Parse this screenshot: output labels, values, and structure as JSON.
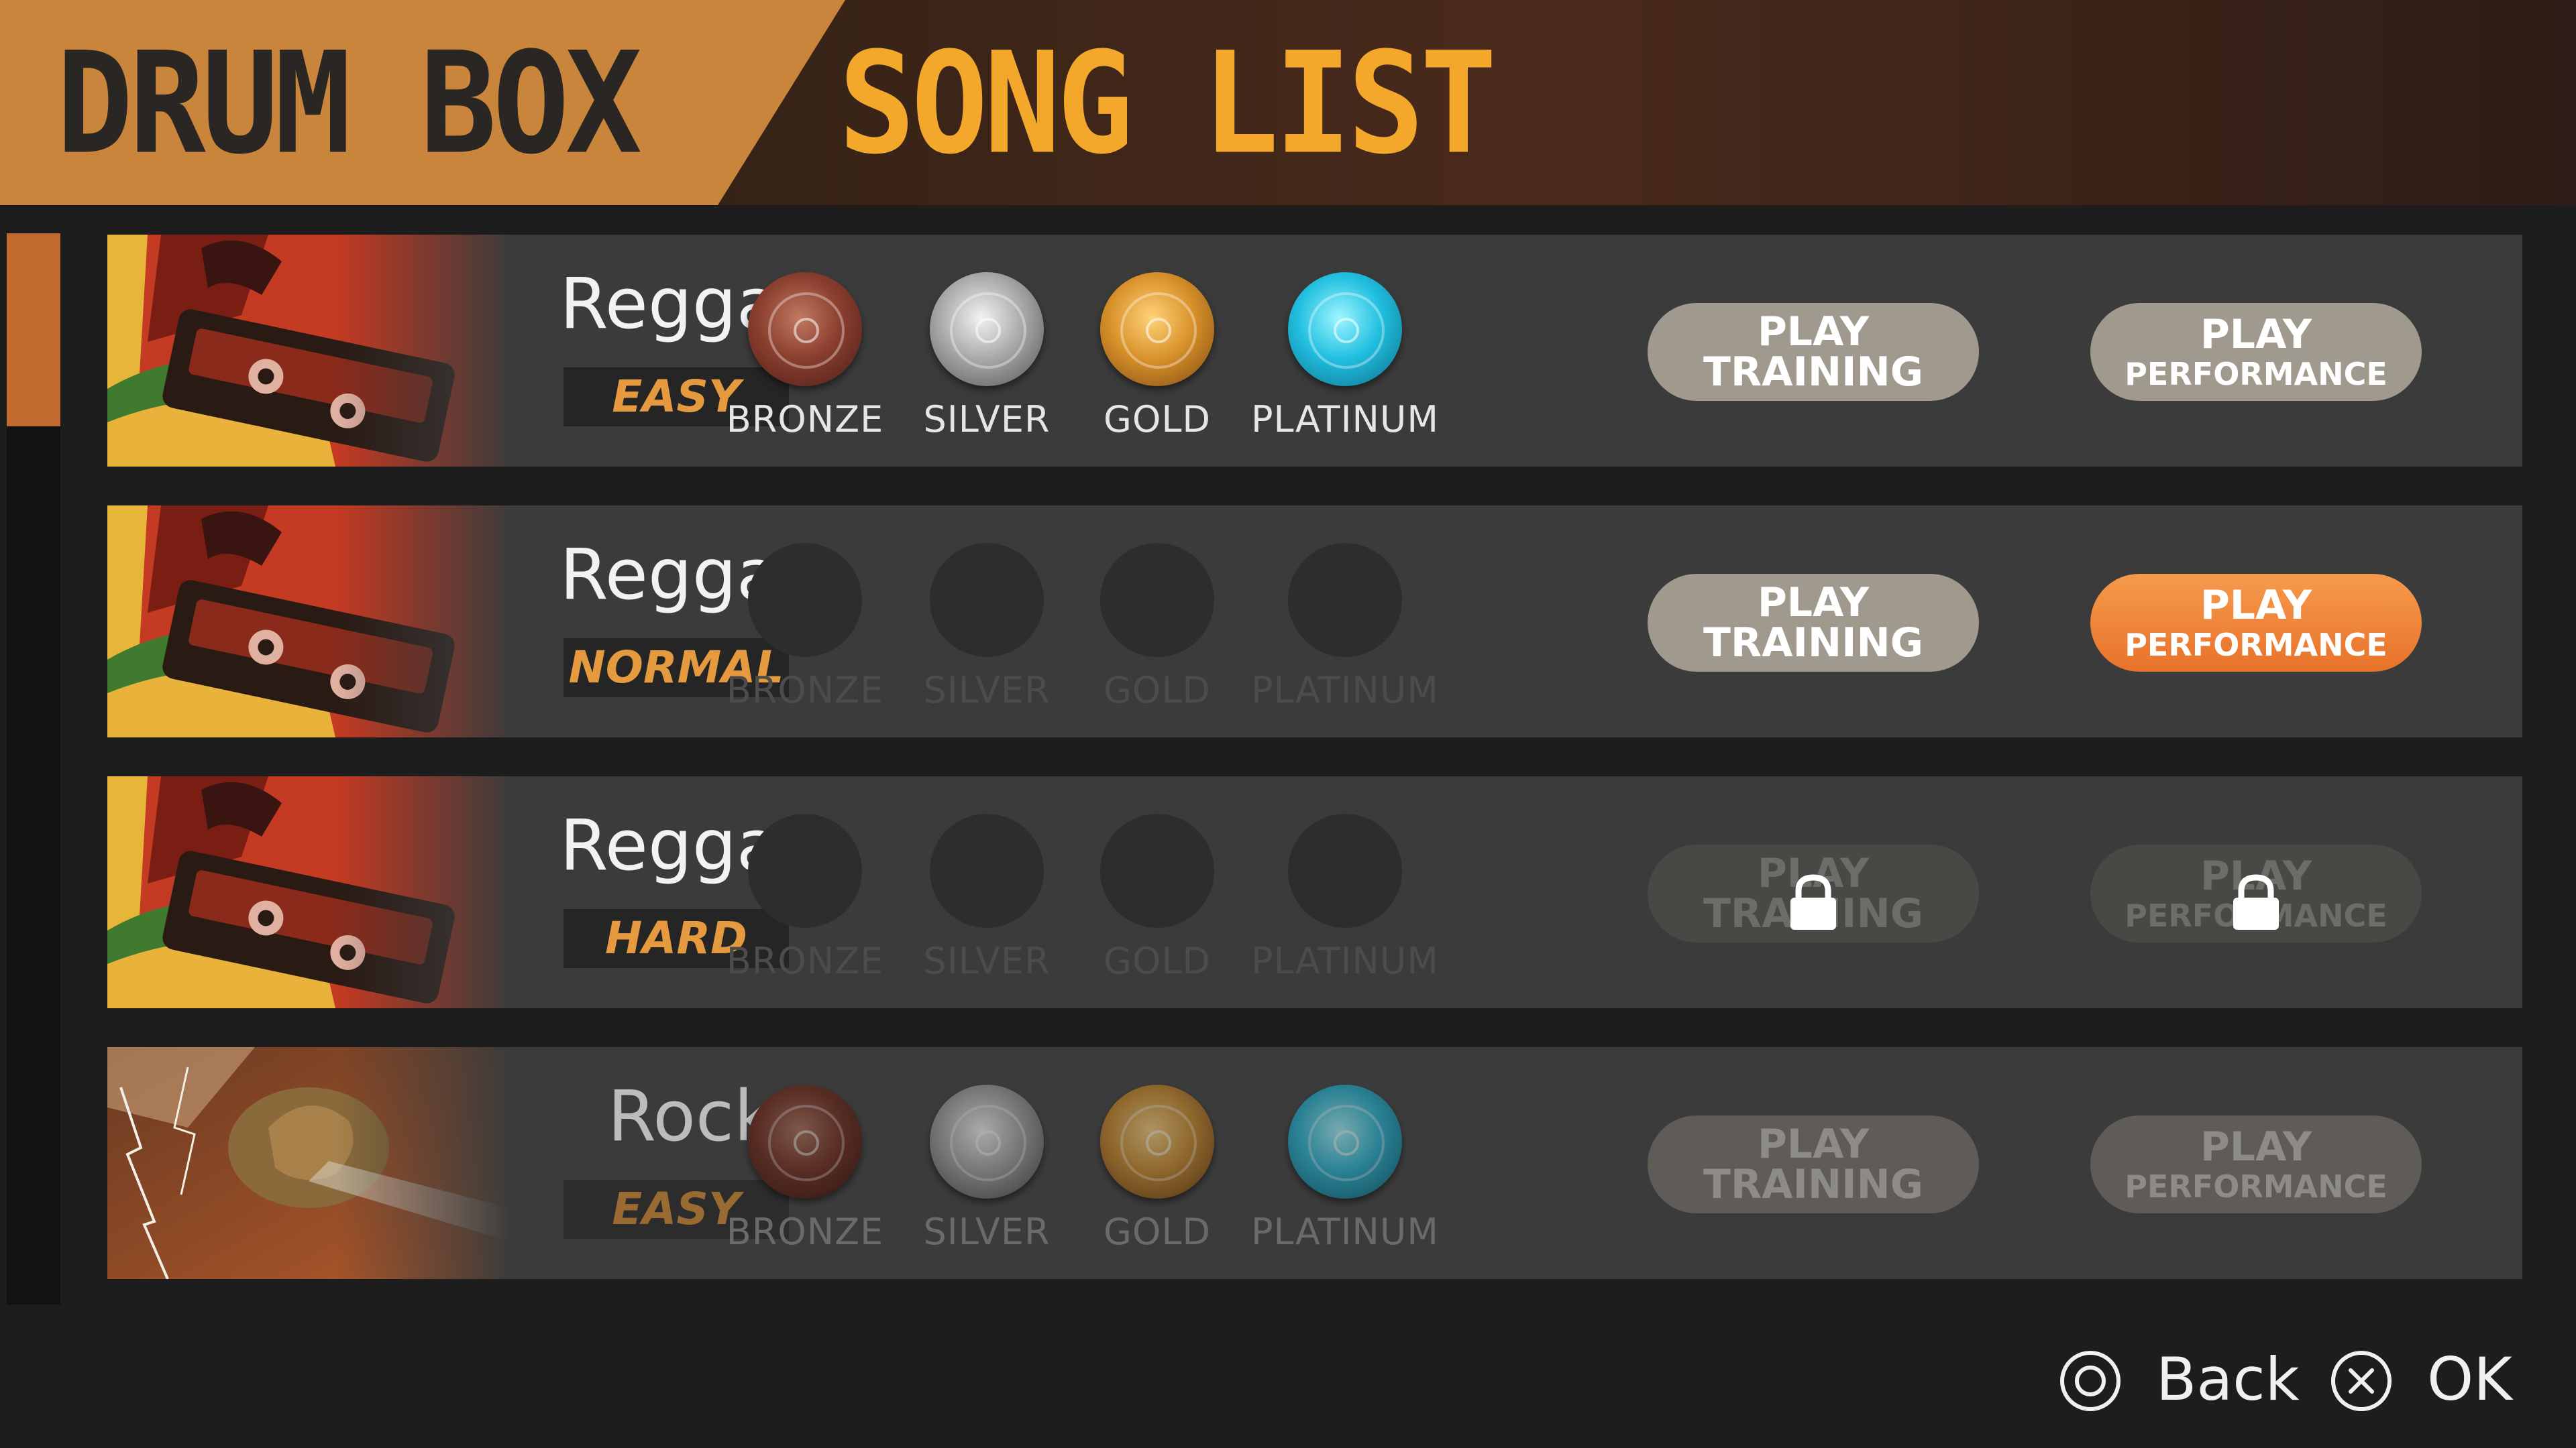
{
  "header": {
    "brand": "DRUM BOX",
    "title": "SONG LIST"
  },
  "colors": {
    "accent_orange": "#e8722a",
    "title_yellow": "#f3a82c",
    "brand_plate": "#c8853b"
  },
  "scrollbar": {
    "position_fraction": 0.0,
    "visible_fraction": 0.18
  },
  "songs": [
    {
      "name": "Reggae",
      "difficulty": "EASY",
      "art": "reggae-cassette",
      "medals": [
        {
          "label": "BRONZE",
          "earned": true
        },
        {
          "label": "SILVER",
          "earned": true
        },
        {
          "label": "GOLD",
          "earned": true
        },
        {
          "label": "PLATINUM",
          "earned": true
        }
      ],
      "training": {
        "line1": "PLAY",
        "line2": "TRAINING",
        "state": "normal"
      },
      "performance": {
        "line1": "PLAY",
        "line2": "PERFORMANCE",
        "state": "normal"
      }
    },
    {
      "name": "Reggae",
      "difficulty": "NORMAL",
      "art": "reggae-cassette",
      "medals": [
        {
          "label": "BRONZE",
          "earned": false
        },
        {
          "label": "SILVER",
          "earned": false
        },
        {
          "label": "GOLD",
          "earned": false
        },
        {
          "label": "PLATINUM",
          "earned": false
        }
      ],
      "training": {
        "line1": "PLAY",
        "line2": "TRAINING",
        "state": "normal"
      },
      "performance": {
        "line1": "PLAY",
        "line2": "PERFORMANCE",
        "state": "selected"
      }
    },
    {
      "name": "Reggae",
      "difficulty": "HARD",
      "art": "reggae-cassette",
      "medals": [
        {
          "label": "BRONZE",
          "earned": false
        },
        {
          "label": "SILVER",
          "earned": false
        },
        {
          "label": "GOLD",
          "earned": false
        },
        {
          "label": "PLATINUM",
          "earned": false
        }
      ],
      "training": {
        "line1": "PLAY",
        "line2": "TRAINING",
        "state": "locked"
      },
      "performance": {
        "line1": "PLAY",
        "line2": "PERFORMANCE",
        "state": "locked"
      }
    },
    {
      "name": "Rock",
      "difficulty": "EASY",
      "art": "rock-lightning",
      "medals": [
        {
          "label": "BRONZE",
          "earned": true
        },
        {
          "label": "SILVER",
          "earned": true
        },
        {
          "label": "GOLD",
          "earned": true
        },
        {
          "label": "PLATINUM",
          "earned": true
        }
      ],
      "training": {
        "line1": "PLAY",
        "line2": "TRAINING",
        "state": "normal"
      },
      "performance": {
        "line1": "PLAY",
        "line2": "PERFORMANCE",
        "state": "normal"
      }
    }
  ],
  "footer": {
    "back_icon": "circle-button-icon",
    "back_label": "Back",
    "ok_icon": "cross-button-icon",
    "ok_label": "OK"
  }
}
